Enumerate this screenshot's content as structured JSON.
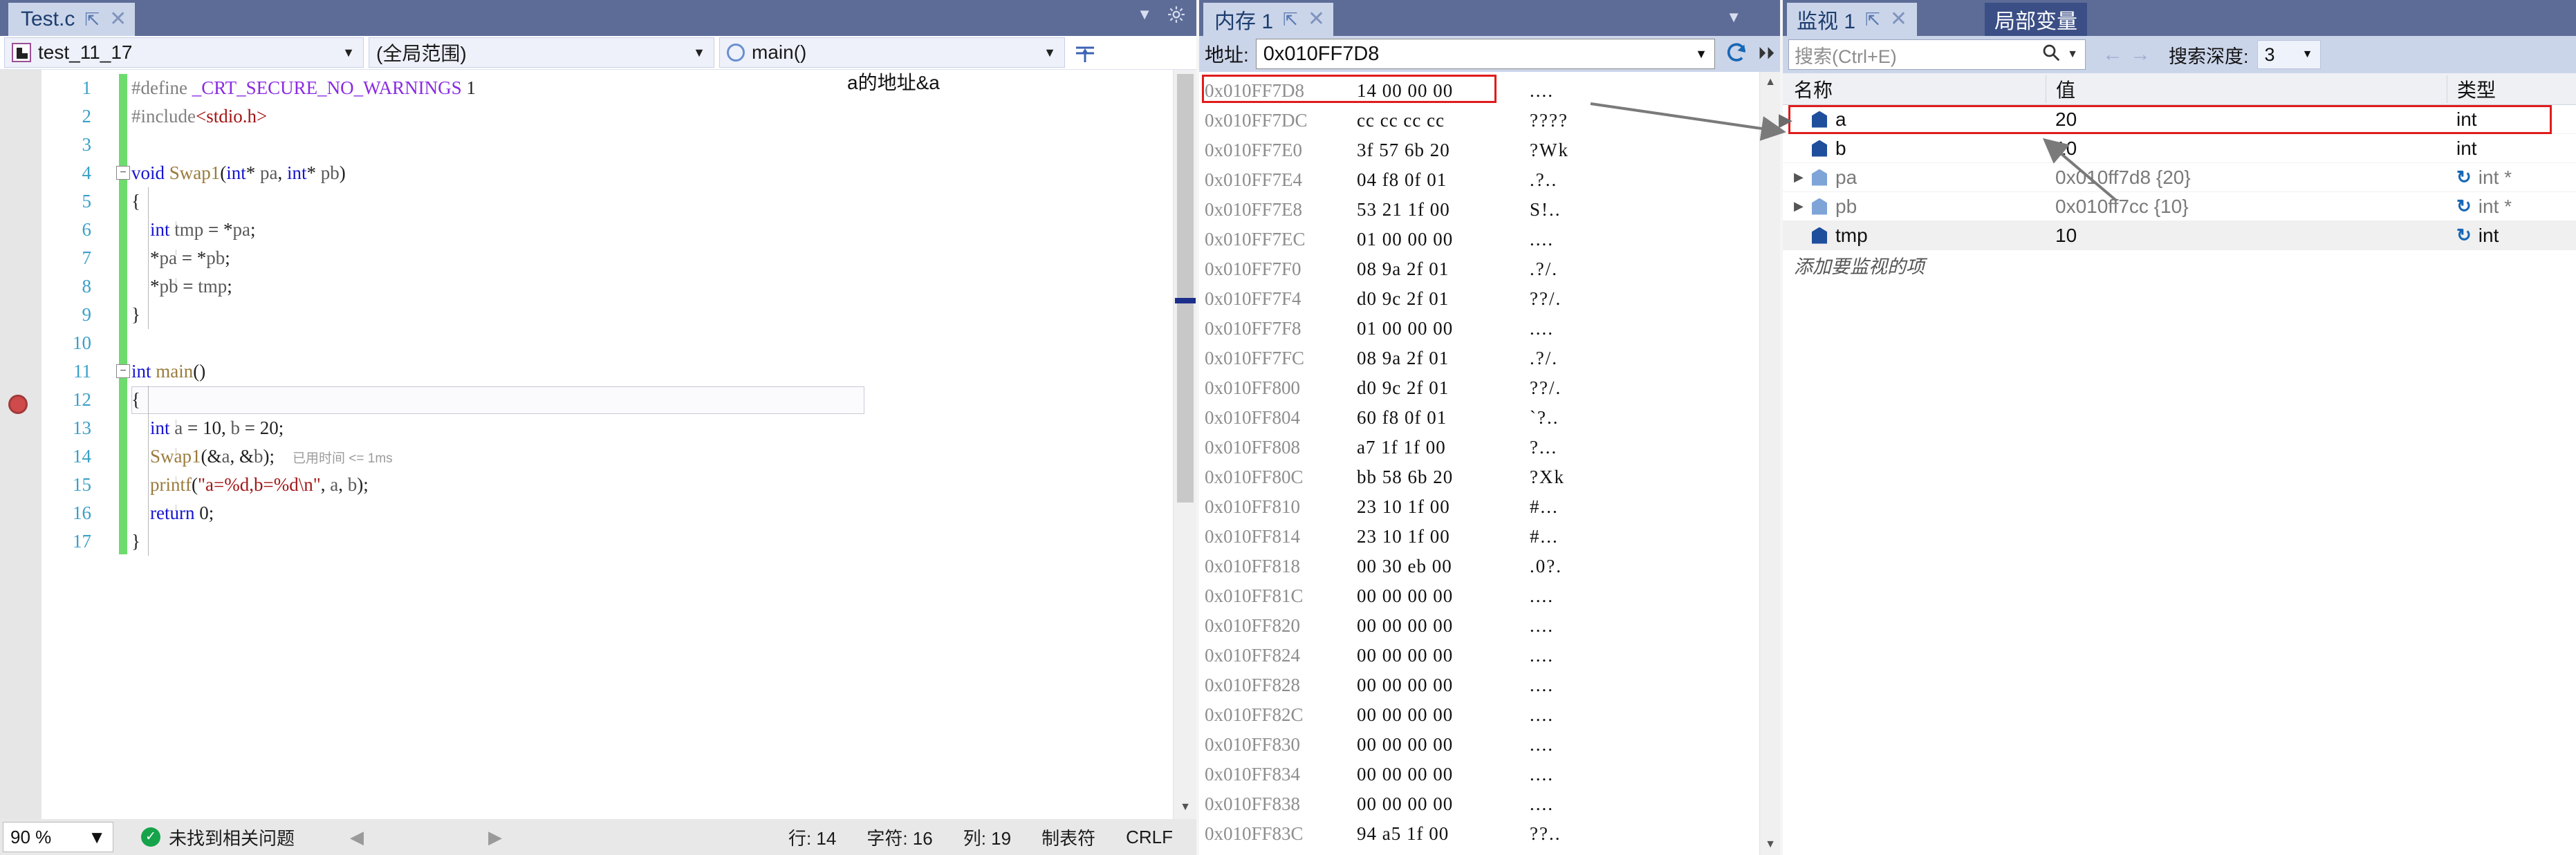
{
  "editor": {
    "tab": {
      "title": "Test.c",
      "pin_icon": "pin-icon",
      "close_icon": "close-icon"
    },
    "nav": {
      "project": "test_11_17",
      "scope": "(全局范围)",
      "function": "main()",
      "caret": "▼"
    },
    "lines": [
      {
        "n": "1",
        "text": "#define _CRT_SECURE_NO_WARNINGS 1"
      },
      {
        "n": "2",
        "text": "#include<stdio.h>"
      },
      {
        "n": "3",
        "text": ""
      },
      {
        "n": "4",
        "text": "void Swap1(int* pa, int* pb)"
      },
      {
        "n": "5",
        "text": "{"
      },
      {
        "n": "6",
        "text": "    int tmp = *pa;"
      },
      {
        "n": "7",
        "text": "    *pa = *pb;"
      },
      {
        "n": "8",
        "text": "    *pb = tmp;"
      },
      {
        "n": "9",
        "text": "}"
      },
      {
        "n": "10",
        "text": ""
      },
      {
        "n": "11",
        "text": "int main()"
      },
      {
        "n": "12",
        "text": "{"
      },
      {
        "n": "13",
        "text": "    int a = 10, b = 20;"
      },
      {
        "n": "14",
        "text": "    Swap1(&a, &b);"
      },
      {
        "n": "15",
        "text": "    printf(\"a=%d,b=%d\\n\", a, b);"
      },
      {
        "n": "16",
        "text": "    return 0;"
      },
      {
        "n": "17",
        "text": "}"
      }
    ],
    "elapsed_hint": "已用时间 <= 1ms",
    "annotation": "a的地址&a"
  },
  "statusbar": {
    "zoom": "90 %",
    "zoom_caret": "▼",
    "issues": "未找到相关问题",
    "prev_arrow": "◀",
    "next_arrow": "▶",
    "line": "行: 14",
    "char": "字符: 16",
    "col": "列: 19",
    "tabs": "制表符",
    "eol": "CRLF"
  },
  "memory": {
    "tab_title": "内存 1",
    "address_label": "地址:",
    "address_value": "0x010FF7D8",
    "refresh_icon": "refresh-icon",
    "overflow_icon": "chevron-double-right-icon",
    "rows": [
      {
        "addr": "0x010FF7D8",
        "hex": "14 00 00 00",
        "ascii": "...."
      },
      {
        "addr": "0x010FF7DC",
        "hex": "cc cc cc cc",
        "ascii": "????"
      },
      {
        "addr": "0x010FF7E0",
        "hex": "3f 57 6b 20",
        "ascii": "?Wk"
      },
      {
        "addr": "0x010FF7E4",
        "hex": "04 f8 0f 01",
        "ascii": ".?.."
      },
      {
        "addr": "0x010FF7E8",
        "hex": "53 21 1f 00",
        "ascii": "S!.."
      },
      {
        "addr": "0x010FF7EC",
        "hex": "01 00 00 00",
        "ascii": "...."
      },
      {
        "addr": "0x010FF7F0",
        "hex": "08 9a 2f 01",
        "ascii": ".?/."
      },
      {
        "addr": "0x010FF7F4",
        "hex": "d0 9c 2f 01",
        "ascii": "??/."
      },
      {
        "addr": "0x010FF7F8",
        "hex": "01 00 00 00",
        "ascii": "...."
      },
      {
        "addr": "0x010FF7FC",
        "hex": "08 9a 2f 01",
        "ascii": ".?/."
      },
      {
        "addr": "0x010FF800",
        "hex": "d0 9c 2f 01",
        "ascii": "??/."
      },
      {
        "addr": "0x010FF804",
        "hex": "60 f8 0f 01",
        "ascii": "`?.."
      },
      {
        "addr": "0x010FF808",
        "hex": "a7 1f 1f 00",
        "ascii": "?..."
      },
      {
        "addr": "0x010FF80C",
        "hex": "bb 58 6b 20",
        "ascii": "?Xk"
      },
      {
        "addr": "0x010FF810",
        "hex": "23 10 1f 00",
        "ascii": "#..."
      },
      {
        "addr": "0x010FF814",
        "hex": "23 10 1f 00",
        "ascii": "#..."
      },
      {
        "addr": "0x010FF818",
        "hex": "00 30 eb 00",
        "ascii": ".0?."
      },
      {
        "addr": "0x010FF81C",
        "hex": "00 00 00 00",
        "ascii": "...."
      },
      {
        "addr": "0x010FF820",
        "hex": "00 00 00 00",
        "ascii": "...."
      },
      {
        "addr": "0x010FF824",
        "hex": "00 00 00 00",
        "ascii": "...."
      },
      {
        "addr": "0x010FF828",
        "hex": "00 00 00 00",
        "ascii": "...."
      },
      {
        "addr": "0x010FF82C",
        "hex": "00 00 00 00",
        "ascii": "...."
      },
      {
        "addr": "0x010FF830",
        "hex": "00 00 00 00",
        "ascii": "...."
      },
      {
        "addr": "0x010FF834",
        "hex": "00 00 00 00",
        "ascii": "...."
      },
      {
        "addr": "0x010FF838",
        "hex": "00 00 00 00",
        "ascii": "...."
      },
      {
        "addr": "0x010FF83C",
        "hex": "94 a5 1f 00",
        "ascii": "??.."
      }
    ]
  },
  "watch": {
    "tab_watch": "监视 1",
    "tab_locals": "局部变量",
    "search_placeholder": "搜索(Ctrl+E)",
    "search_icon": "search-icon",
    "back_arrow": "←",
    "forward_arrow": "→",
    "depth_label": "搜索深度:",
    "depth_value": "3",
    "columns": {
      "name": "名称",
      "value": "值",
      "type": "类型"
    },
    "rows": [
      {
        "expander": "",
        "name": "a",
        "value": "20",
        "type": "int",
        "refresh": false,
        "gray": false
      },
      {
        "expander": "",
        "name": "b",
        "value": "10",
        "type": "int",
        "refresh": false,
        "gray": false
      },
      {
        "expander": "▶",
        "name": "pa",
        "value": "0x010ff7d8 {20}",
        "type": "int *",
        "refresh": true,
        "gray": true
      },
      {
        "expander": "▶",
        "name": "pb",
        "value": "0x010ff7cc {10}",
        "type": "int *",
        "refresh": true,
        "gray": true
      },
      {
        "expander": "",
        "name": "tmp",
        "value": "10",
        "type": "int",
        "refresh": true,
        "gray": false
      }
    ],
    "add_item": "添加要监视的项"
  },
  "colors": {
    "tab_active_bg": "#cbd5ea",
    "titlebar_bg": "#5d6c97",
    "highlight_red": "#e01b1b",
    "change_bar_green": "#6ddc6d",
    "keyword_blue": "#1414d2",
    "string_red": "#a31515",
    "macro_purple": "#8a2be2"
  }
}
